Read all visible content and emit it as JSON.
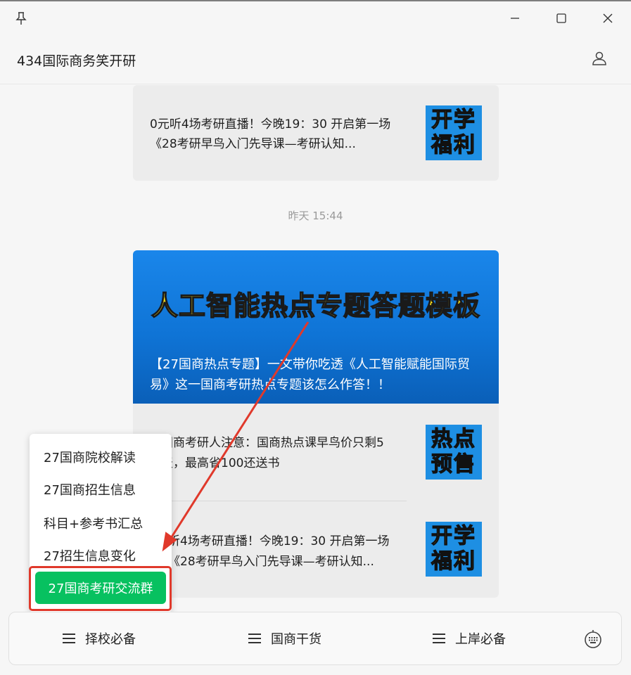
{
  "window": {
    "pin_icon": "pin-icon",
    "minimize_icon": "minimize-icon",
    "maximize_icon": "maximize-icon",
    "close_icon": "close-icon"
  },
  "header": {
    "title": "434国际商务笑开研",
    "user_icon": "user-icon"
  },
  "messages": {
    "top_card": {
      "text": "0元听4场考研直播！今晚19：30 开启第一场《28考研早鸟入门先导课—考研认知...",
      "badge_line1": "开学",
      "badge_line2": "福利"
    },
    "timestamp": "昨天 15:44",
    "hero": {
      "image_title": "人工智能热点专题答题模板",
      "caption": "【27国商热点专题】一文带你吃透《人工智能赋能国际贸易》这一国商考研热点专题该怎么作答！！"
    },
    "item2": {
      "text": "国商考研人注意：国商热点课早鸟价只剩5天，最高省100还送书",
      "badge_line1": "热点",
      "badge_line2": "预售"
    },
    "item3": {
      "text": "听4场考研直播！今晚19：30 开启第一场《28考研早鸟入门先导课—考研认知...",
      "badge_line1": "开学",
      "badge_line2": "福利"
    }
  },
  "popup_menu": {
    "items": [
      "27国商院校解读",
      "27国商招生信息",
      "科目+参考书汇总",
      "27招生信息变化"
    ],
    "active_item": "27国商考研交流群"
  },
  "bottom_menu": {
    "items": [
      "择校必备",
      "国商干货",
      "上岸必备"
    ],
    "keyboard_icon": "keyboard-icon"
  },
  "colors": {
    "accent_green": "#07c160",
    "annotation_red": "#e0392b",
    "badge_blue": "#1e8fe3",
    "badge_yellow": "#ffd21a"
  }
}
